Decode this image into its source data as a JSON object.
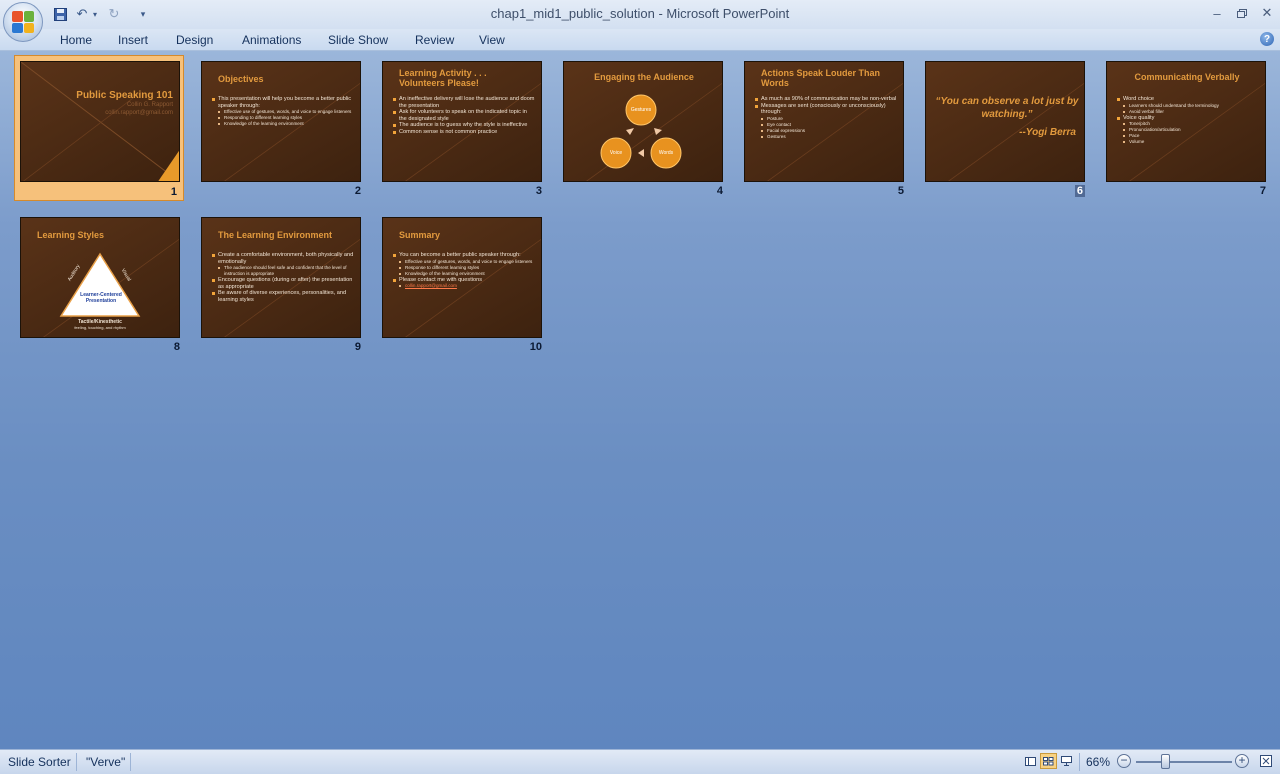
{
  "window": {
    "title": "chap1_mid1_public_solution - Microsoft PowerPoint",
    "minimize_icon": "minimize-icon",
    "restore_icon": "restore-icon",
    "close_icon": "close-icon"
  },
  "quick_access": {
    "save_icon": "save-icon",
    "undo_icon": "undo-icon",
    "redo_icon": "redo-icon",
    "customize_icon": "dropdown-icon"
  },
  "ribbon": {
    "tabs": [
      "Home",
      "Insert",
      "Design",
      "Animations",
      "Slide Show",
      "Review",
      "View"
    ]
  },
  "slides": [
    {
      "number": "1",
      "title": "Public Speaking 101",
      "subtitle_1": "Collin G. Rapport",
      "subtitle_2": "collin.rapport@gmail.com"
    },
    {
      "number": "2",
      "title": "Objectives",
      "bullets": [
        {
          "text": "This presentation will help you become a better public speaker through:",
          "level": 1
        },
        {
          "text": "Effective use of gestures, words, and voice to engage listeners",
          "level": 2
        },
        {
          "text": "Responding to different learning styles",
          "level": 2
        },
        {
          "text": "Knowledge of the learning environment",
          "level": 2
        }
      ]
    },
    {
      "number": "3",
      "title": "Learning Activity . . . Volunteers Please!",
      "bullets": [
        {
          "text": "An ineffective delivery will lose the audience and doom the presentation",
          "level": 1
        },
        {
          "text": "Ask for volunteers to speak on the indicated topic in the designated style",
          "level": 1
        },
        {
          "text": "The audience is to guess why the style is ineffective",
          "level": 1
        },
        {
          "text": "Common sense is not common practice",
          "level": 1
        }
      ]
    },
    {
      "number": "4",
      "title": "Engaging the Audience",
      "circle_1": "Gestures",
      "circle_2": "Voice",
      "circle_3": "Words"
    },
    {
      "number": "5",
      "title": "Actions Speak Louder Than Words",
      "bullets": [
        {
          "text": "As much as 90% of communication may be non-verbal",
          "level": 1
        },
        {
          "text": "Messages are sent (consciously or unconsciously) through:",
          "level": 1
        },
        {
          "text": "Posture",
          "level": 2
        },
        {
          "text": "Eye contact",
          "level": 2
        },
        {
          "text": "Facial expressions",
          "level": 2
        },
        {
          "text": "Gestures",
          "level": 2
        }
      ]
    },
    {
      "number": "6",
      "quote": "“You can observe a lot just by watching.”",
      "author": "--Yogi Berra"
    },
    {
      "number": "7",
      "title": "Communicating Verbally",
      "bullets": [
        {
          "text": "Word choice",
          "level": 1
        },
        {
          "text": "Learners should understand the terminology",
          "level": 2
        },
        {
          "text": "Avoid verbal filler",
          "level": 2
        },
        {
          "text": "Voice quality",
          "level": 1
        },
        {
          "text": "Tone/pitch",
          "level": 2
        },
        {
          "text": "Pronunciation/articulation",
          "level": 2
        },
        {
          "text": "Pace",
          "level": 2
        },
        {
          "text": "Volume",
          "level": 2
        }
      ]
    },
    {
      "number": "8",
      "title": "Learning Styles",
      "center_1": "Learner-Centered",
      "center_2": "Presentation",
      "left_side": "Auditory",
      "right_side": "Visual",
      "bottom_1": "Tactile/Kinesthetic",
      "bottom_2": "feeling, touching, and rhythm"
    },
    {
      "number": "9",
      "title": "The Learning Environment",
      "bullets": [
        {
          "text": "Create a comfortable environment, both physically and emotionally",
          "level": 1
        },
        {
          "text": "The audience should feel safe and confident that the level of instruction is appropriate",
          "level": 2
        },
        {
          "text": "Encourage questions (during or after) the presentation as appropriate",
          "level": 1
        },
        {
          "text": "Be aware of diverse experiences, personalities, and learning styles",
          "level": 1
        }
      ]
    },
    {
      "number": "10",
      "title": "Summary",
      "bullets": [
        {
          "text": "You can become a better public speaker through:",
          "level": 1
        },
        {
          "text": "Effective use of gestures, words, and voice to engage listeners",
          "level": 2
        },
        {
          "text": "Response to different learning styles",
          "level": 2
        },
        {
          "text": "Knowledge of the learning environment",
          "level": 2
        },
        {
          "text": "Please contact me with questions",
          "level": 1
        },
        {
          "text": "collin.rapport@gmail.com",
          "level": 2,
          "link": true
        }
      ]
    }
  ],
  "status_bar": {
    "view_name": "Slide Sorter",
    "theme": "\"Verve\"",
    "zoom": "66%",
    "zoom_level_percent": 66
  },
  "colors": {
    "accent": "#e29a3e",
    "selected": "#f6c17b",
    "background": "#6a8ec2"
  }
}
